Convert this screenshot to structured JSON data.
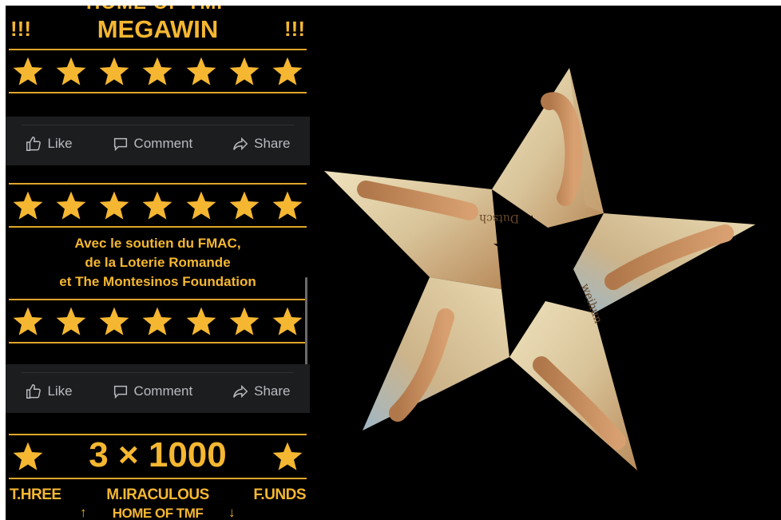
{
  "post": {
    "top_line": "HOME OF TMF",
    "megawin": "MEGAWIN",
    "bang": "!!!",
    "stars_per_row": 7,
    "support_lines": [
      "Avec le soutien du FMAC,",
      "de la Loterie Romande",
      "et The Montesinos Foundation"
    ],
    "prize": "3 × 1000",
    "bottom_words": [
      "T.HREE",
      "M.IRACULOUS",
      "F.UNDS"
    ],
    "bottom_line": "HOME OF TMF",
    "arrow_up": "↑",
    "arrow_down": "↓"
  },
  "actions": {
    "like": "Like",
    "comment": "Comment",
    "share": "Share"
  },
  "photo": {
    "subject": "origami star folded from banknotes",
    "note_text_a": "Dutsch",
    "note_text_b": "weihun"
  },
  "colors": {
    "gold": "#f5b731",
    "rule": "#e0a52b",
    "action_bar": "#1c1d1f",
    "action_text": "#b8bbbf",
    "paper_light": "#e8dcb8",
    "paper_dark": "#b88a5a"
  }
}
